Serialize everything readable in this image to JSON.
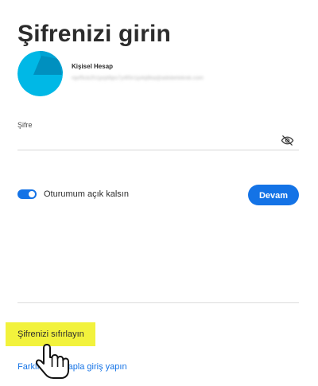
{
  "page": {
    "title": "Şifrenizi girin"
  },
  "account": {
    "name": "Kişisel Hesap",
    "email": "rqvf5cb2h1prpt6ps7y4f0n1p4q8ka@adobeteknik.com",
    "avatar_colors": [
      "#00b8e6",
      "#0073a8"
    ]
  },
  "password": {
    "label": "Şifre",
    "value": "",
    "placeholder": "",
    "toggle_icon": "eye-off-icon"
  },
  "remember": {
    "label": "Oturumum açık kalsın",
    "checked": true
  },
  "continue_button": {
    "label": "Devam"
  },
  "links": {
    "reset_password": "Şifrenizi sıfırlayın",
    "other_account": "Farklı bir hesapla giriş yapın"
  },
  "colors": {
    "accent": "#1473e6",
    "highlight": "#f2f23c",
    "text": "#2c2c2c"
  },
  "overlay": {
    "cursor_icon": "hand-pointer-icon"
  }
}
